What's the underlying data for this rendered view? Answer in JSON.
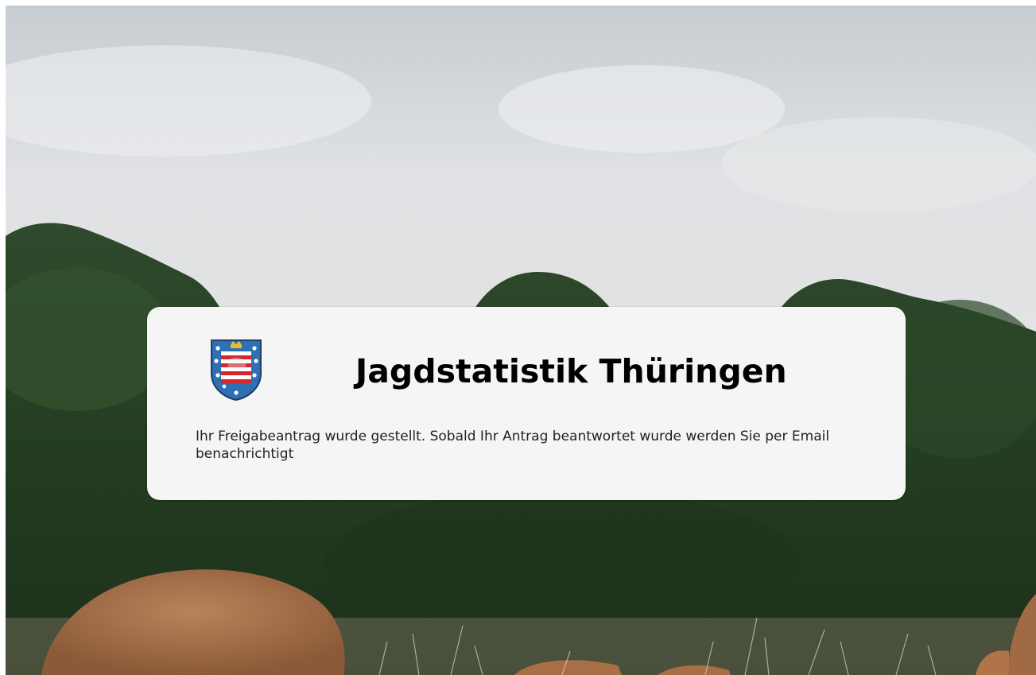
{
  "app": {
    "title": "Jagdstatistik Thüringen",
    "logo_icon": "thuringia-coat-of-arms-icon"
  },
  "notice": {
    "message": "Ihr Freigabeantrag wurde gestellt. Sobald Ihr Antrag beantwortet wurde werden Sie per Email benachrichtigt"
  },
  "colors": {
    "card_background": "#f5f5f5",
    "title_text": "#000000",
    "message_text": "#222222",
    "coat_blue": "#2f6fb3",
    "coat_red": "#d6262b"
  }
}
